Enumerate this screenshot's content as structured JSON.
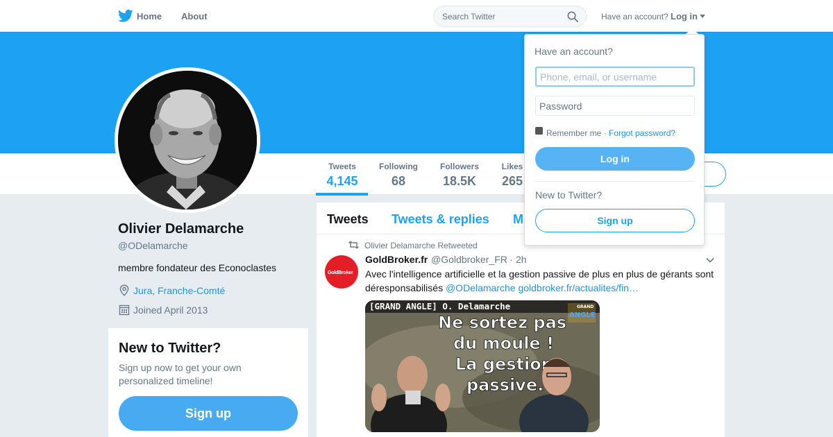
{
  "nav": {
    "home": "Home",
    "about": "About",
    "search_placeholder": "Search Twitter",
    "have_account": "Have an account?",
    "login": "Log in"
  },
  "profile": {
    "name": "Olivier Delamarche",
    "handle": "@ODelamarche",
    "bio": "membre fondateur des Econoclastes",
    "location": "Jura, Franche-Comté",
    "joined": "Joined April 2013"
  },
  "stats": [
    {
      "label": "Tweets",
      "value": "4,145"
    },
    {
      "label": "Following",
      "value": "68"
    },
    {
      "label": "Followers",
      "value": "18.5K"
    },
    {
      "label": "Likes",
      "value": "265"
    }
  ],
  "sidebar_signup": {
    "title": "New to Twitter?",
    "text": "Sign up now to get your own personalized timeline!",
    "button": "Sign up"
  },
  "timeline": {
    "tabs": [
      "Tweets",
      "Tweets & replies",
      "M"
    ],
    "retweet_by": "Olivier Delamarche Retweeted",
    "tweet": {
      "author": "GoldBroker.fr",
      "handle": "@Goldbroker_FR",
      "separator": "·",
      "time": "2h",
      "text_line1": "Avec l'intelligence artificielle et la gestion passive de plus en plus de gérants sont",
      "text_line2": "déresponsabilisés",
      "mention": "@ODelamarche",
      "link": "goldbroker.fr/actualites/fin…",
      "avatar_logo": "GoldBroker",
      "media": {
        "header": "[GRAND ANGLE] O. Delamarche",
        "badge_top": "GRAND",
        "badge_bottom": "ANGLE",
        "line1": "Ne sortez pas",
        "line2": "du moule !",
        "line3": "La gestion",
        "line4": "passive."
      }
    }
  },
  "login_dropdown": {
    "title": "Have an account?",
    "username_placeholder": "Phone, email, or username",
    "password_placeholder": "Password",
    "remember": "Remember me",
    "separator": "·",
    "forgot": "Forgot password?",
    "login_button": "Log in",
    "new_to_twitter": "New to Twitter?",
    "signup_button": "Sign up"
  },
  "colors": {
    "brand": "#1da1f2",
    "link": "#1b95e0",
    "muted": "#657786",
    "page_bg": "#e6ecf0"
  }
}
